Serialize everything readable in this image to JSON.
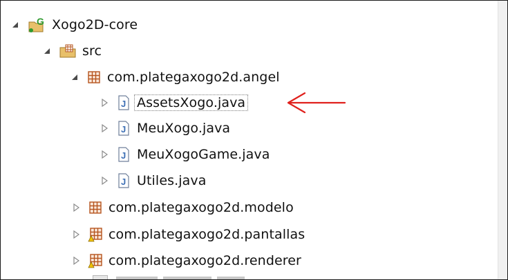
{
  "tree": {
    "project": {
      "label": "Xogo2D-core",
      "icon": "gdx-project-icon",
      "expanded": true
    },
    "src": {
      "label": "src",
      "icon": "source-folder-icon",
      "expanded": true
    },
    "packages": [
      {
        "label": "com.plategaxogo2d.angel",
        "icon": "package-icon",
        "expanded": true,
        "files": [
          {
            "label": "AssetsXogo.java",
            "icon": "java-file-icon",
            "selected": true
          },
          {
            "label": "MeuXogo.java",
            "icon": "java-file-icon"
          },
          {
            "label": "MeuXogoGame.java",
            "icon": "java-file-icon"
          },
          {
            "label": "Utiles.java",
            "icon": "java-file-icon"
          }
        ]
      },
      {
        "label": "com.plategaxogo2d.modelo",
        "icon": "package-icon",
        "expanded": false
      },
      {
        "label": "com.plategaxogo2d.pantallas",
        "icon": "package-warning-icon",
        "expanded": false
      },
      {
        "label": "com.plategaxogo2d.renderer",
        "icon": "package-warning-icon",
        "expanded": false
      }
    ]
  },
  "annotation": {
    "icon": "red-arrow-icon",
    "color": "#e0201c"
  },
  "colors": {
    "package": "#b5531d",
    "java_badge": "#3d6fb5",
    "gdx_green": "#2f9a2f"
  }
}
